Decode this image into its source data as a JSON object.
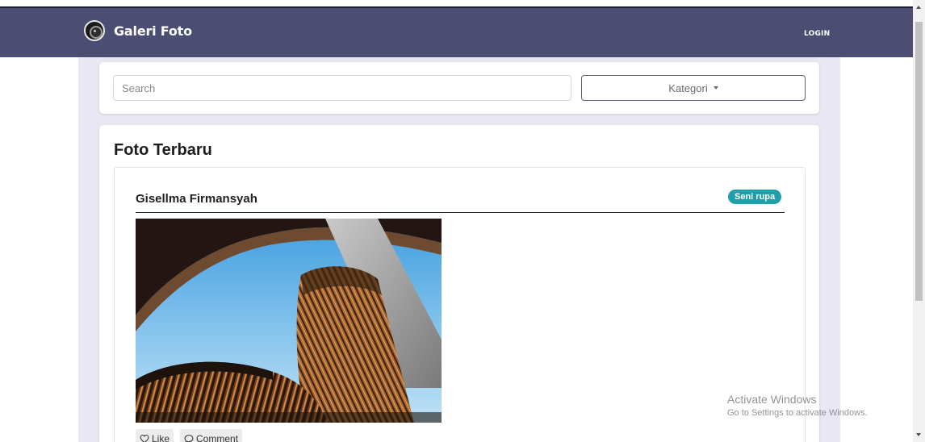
{
  "navbar": {
    "brand": "Galeri Foto",
    "login_label": "LOGIN"
  },
  "search": {
    "placeholder": "Search",
    "kategori_label": "Kategori"
  },
  "main": {
    "section_title": "Foto Terbaru",
    "post": {
      "author": "Gisellma Firmansyah",
      "category_badge": "Seni rupa",
      "like_label": "Like",
      "comment_label": "Comment"
    }
  },
  "watermark": {
    "title": "Activate Windows",
    "subtitle": "Go to Settings to activate Windows."
  },
  "colors": {
    "navbar": "#4b4d72",
    "page_bg": "#e9e7f4",
    "badge": "#1f9fa8"
  }
}
